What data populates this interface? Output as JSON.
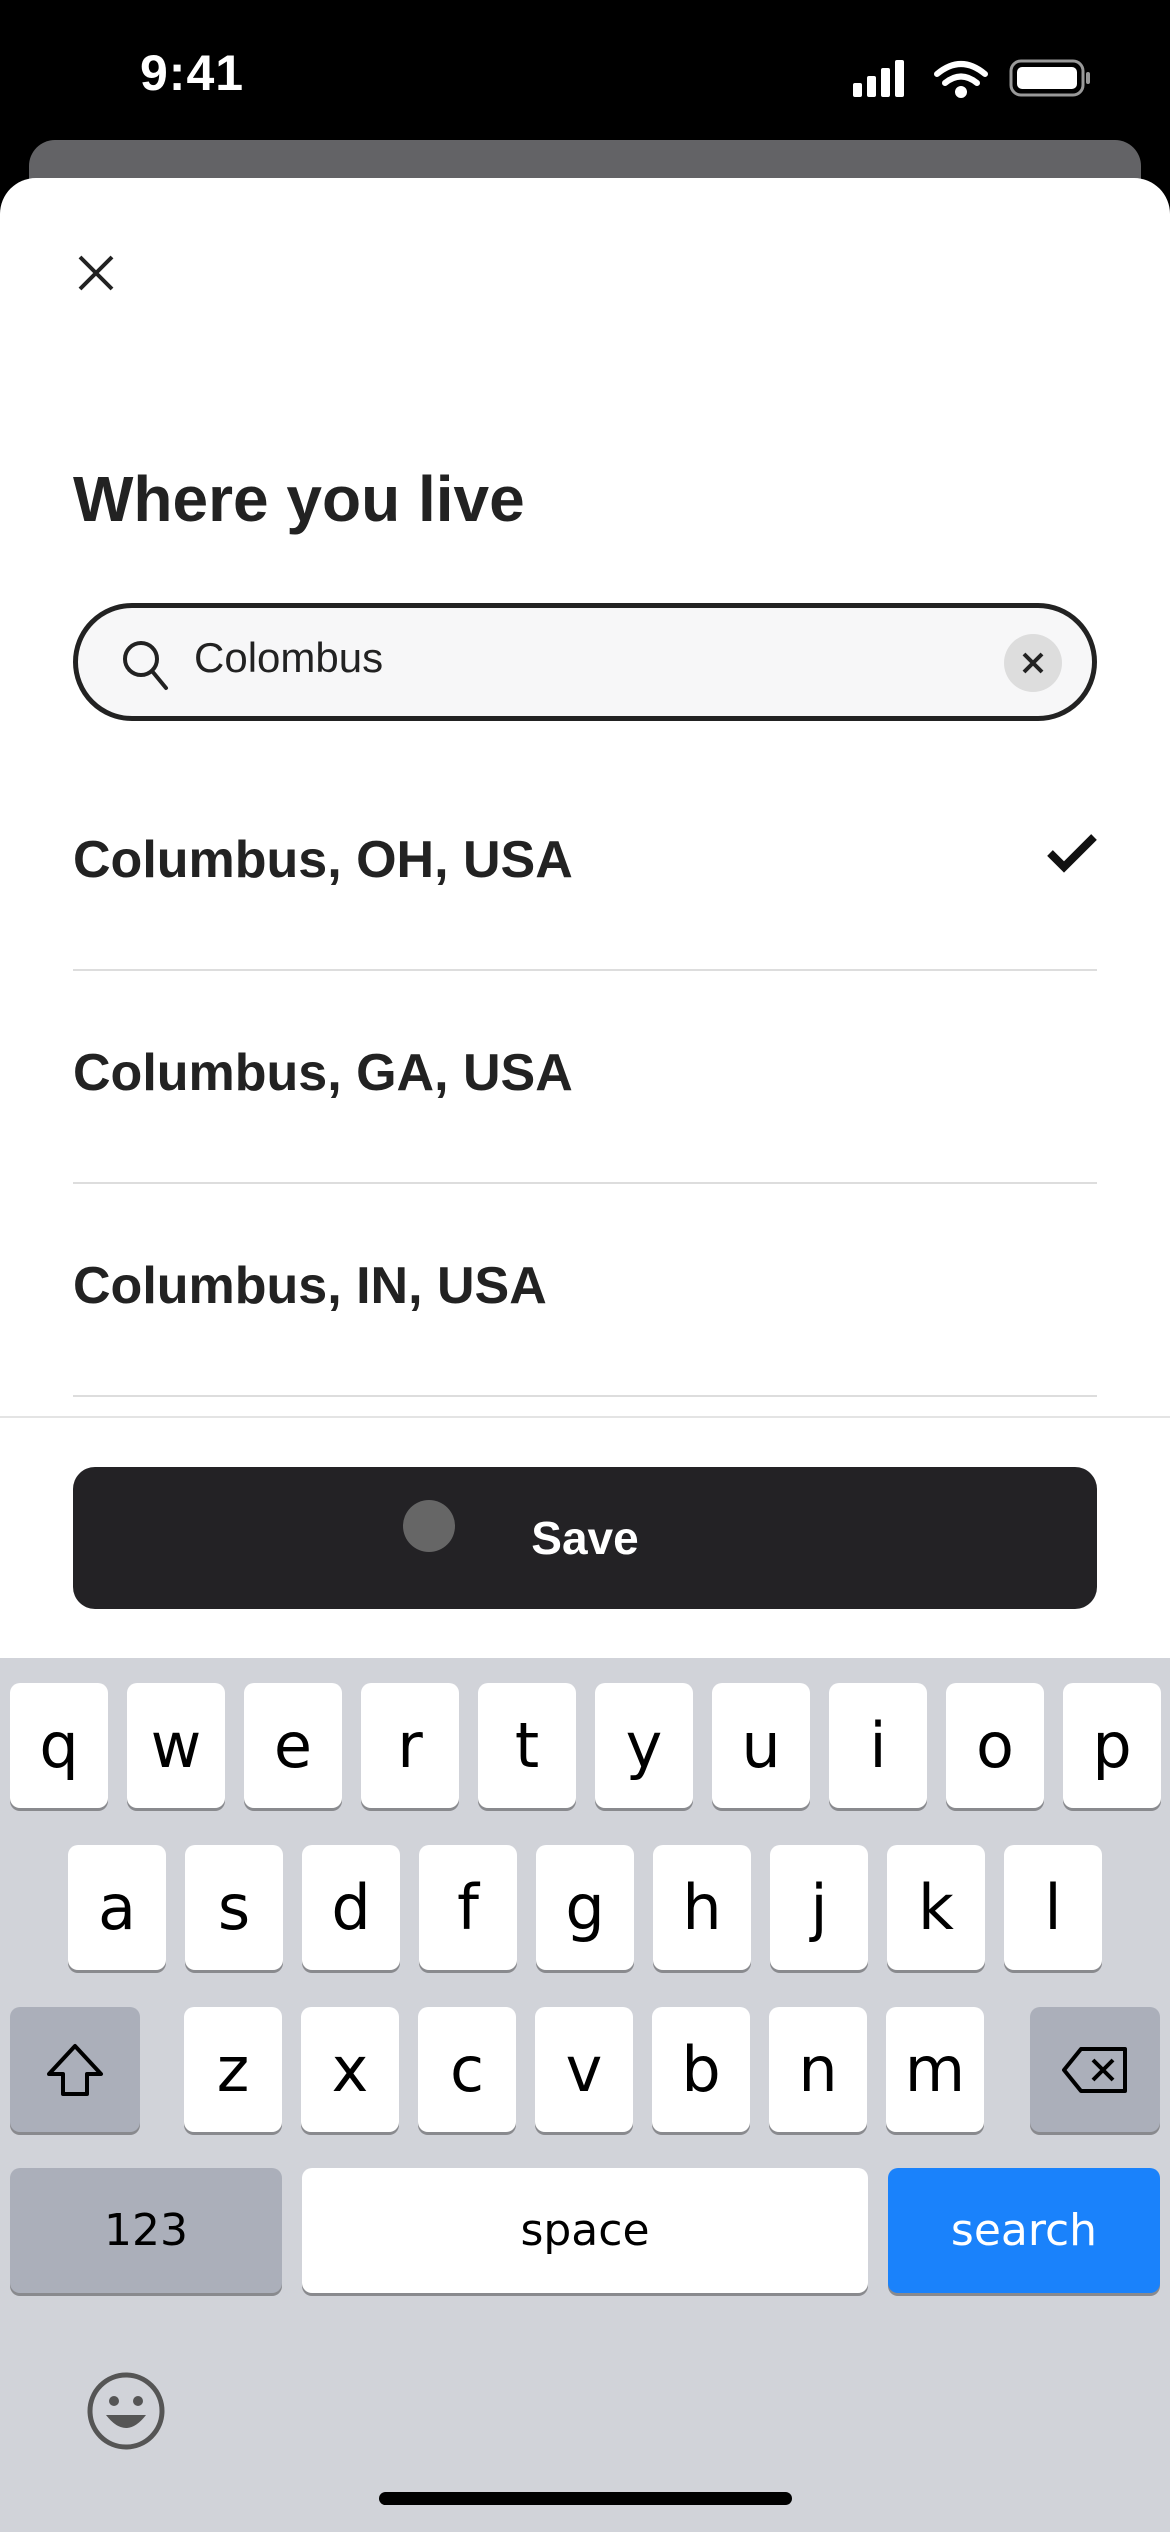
{
  "status_bar": {
    "time": "9:41"
  },
  "sheet": {
    "title": "Where you live",
    "search": {
      "value": "Colombus",
      "placeholder": ""
    },
    "results": [
      {
        "label": "Columbus, OH, USA",
        "selected": true
      },
      {
        "label": "Columbus, GA, USA",
        "selected": false
      },
      {
        "label": "Columbus, IN, USA",
        "selected": false
      }
    ],
    "save_label": "Save"
  },
  "keyboard": {
    "row1": [
      "q",
      "w",
      "e",
      "r",
      "t",
      "y",
      "u",
      "i",
      "o",
      "p"
    ],
    "row2": [
      "a",
      "s",
      "d",
      "f",
      "g",
      "h",
      "j",
      "k",
      "l"
    ],
    "row3": [
      "z",
      "x",
      "c",
      "v",
      "b",
      "n",
      "m"
    ],
    "numbers_label": "123",
    "space_label": "space",
    "search_label": "search",
    "accent": "#1a82fb"
  }
}
